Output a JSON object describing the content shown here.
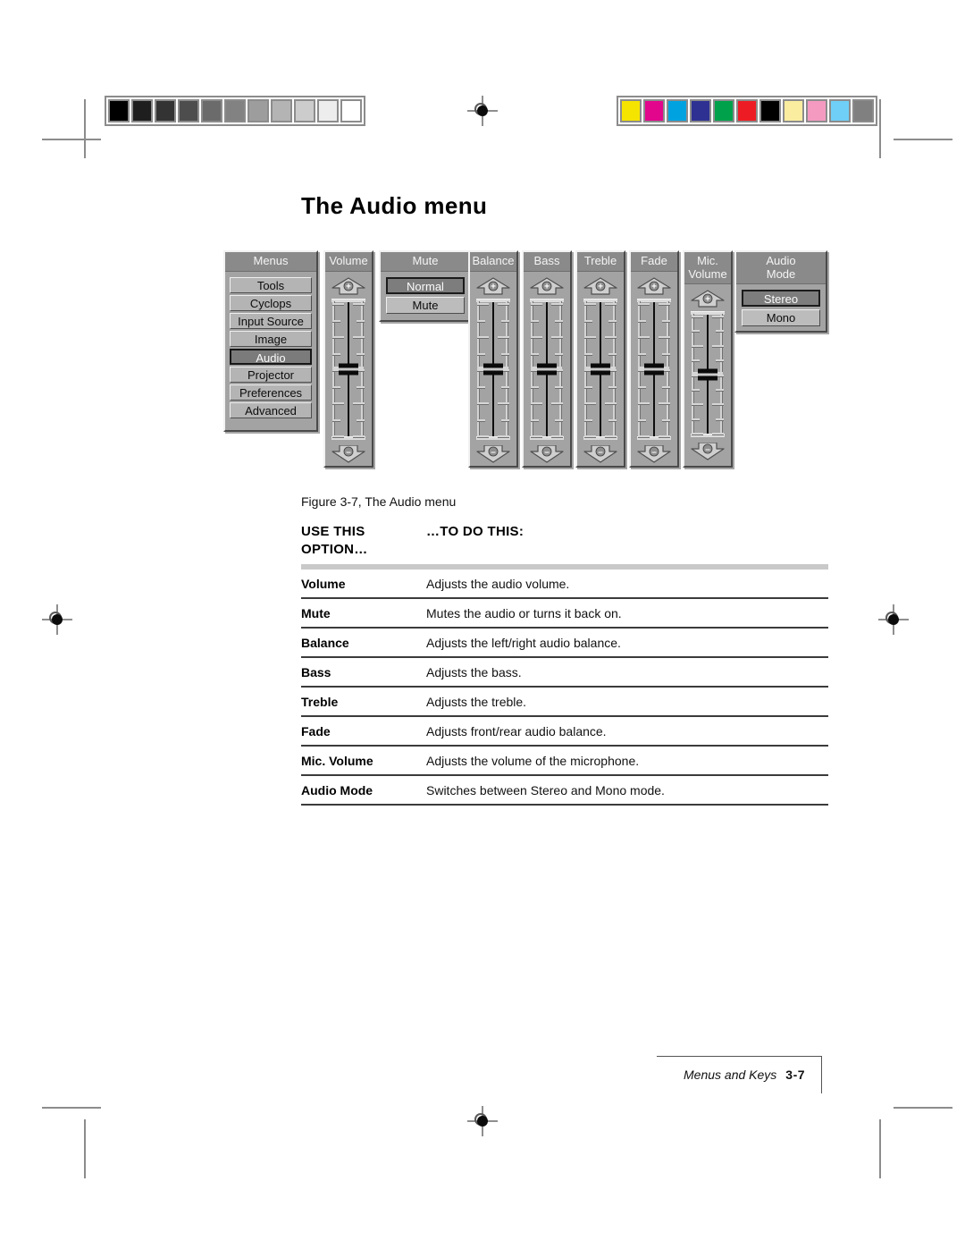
{
  "page": {
    "title": "The Audio menu",
    "figure_caption": "Figure 3-7, The Audio menu",
    "footer_text": "Menus and Keys",
    "footer_page": "3-7"
  },
  "calibration": {
    "gray_strip": [
      "#000000",
      "#1e1e1e",
      "#333333",
      "#4d4d4d",
      "#6b6b6b",
      "#828282",
      "#9d9d9d",
      "#b4b4b4",
      "#cccccc",
      "#ededed",
      "#ffffff"
    ],
    "color_strip": [
      "#f5e300",
      "#e2068c",
      "#00a3e0",
      "#2e3192",
      "#00a14b",
      "#ed1c24",
      "#000000",
      "#faeda0",
      "#f49ac1",
      "#6fcff6",
      "#808080"
    ]
  },
  "osd": {
    "menus_panel": {
      "header": "Menus",
      "items": [
        {
          "label": "Tools",
          "selected": false
        },
        {
          "label": "Cyclops",
          "selected": false
        },
        {
          "label": "Input Source",
          "selected": false
        },
        {
          "label": "Image",
          "selected": false
        },
        {
          "label": "Audio",
          "selected": true
        },
        {
          "label": "Projector",
          "selected": false
        },
        {
          "label": "Preferences",
          "selected": false
        },
        {
          "label": "Advanced",
          "selected": false
        }
      ]
    },
    "sliders": [
      {
        "header": "Volume",
        "header_line2": "",
        "position_pct": 50,
        "plus": "+",
        "minus": "–"
      },
      {
        "header": "Balance",
        "header_line2": "",
        "position_pct": 50,
        "plus": "+",
        "minus": "–"
      },
      {
        "header": "Bass",
        "header_line2": "",
        "position_pct": 50,
        "plus": "+",
        "minus": "–"
      },
      {
        "header": "Treble",
        "header_line2": "",
        "position_pct": 50,
        "plus": "+",
        "minus": "–"
      },
      {
        "header": "Fade",
        "header_line2": "",
        "position_pct": 50,
        "plus": "+",
        "minus": "–"
      },
      {
        "header": "Mic.",
        "header_line2": "Volume",
        "position_pct": 50,
        "plus": "+",
        "minus": "–"
      }
    ],
    "mute_panel": {
      "header": "Mute",
      "options": [
        {
          "label": "Normal",
          "selected": true
        },
        {
          "label": "Mute",
          "selected": false
        }
      ]
    },
    "audio_mode_panel": {
      "header": "Audio",
      "header_line2": "Mode",
      "options": [
        {
          "label": "Stereo",
          "selected": true
        },
        {
          "label": "Mono",
          "selected": false
        }
      ]
    }
  },
  "table": {
    "header_col1_line1": "USE THIS",
    "header_col1_line2": "OPTION…",
    "header_col2": "…TO DO THIS:",
    "rows": [
      {
        "option": "Volume",
        "description": "Adjusts the audio volume."
      },
      {
        "option": "Mute",
        "description": "Mutes the audio or turns it back on."
      },
      {
        "option": "Balance",
        "description": "Adjusts the left/right audio balance."
      },
      {
        "option": "Bass",
        "description": "Adjusts the bass."
      },
      {
        "option": "Treble",
        "description": "Adjusts the treble."
      },
      {
        "option": "Fade",
        "description": "Adjusts front/rear audio balance."
      },
      {
        "option": "Mic. Volume",
        "description": "Adjusts the volume of the microphone."
      },
      {
        "option": "Audio Mode",
        "description": "Switches between Stereo and Mono mode."
      }
    ]
  }
}
